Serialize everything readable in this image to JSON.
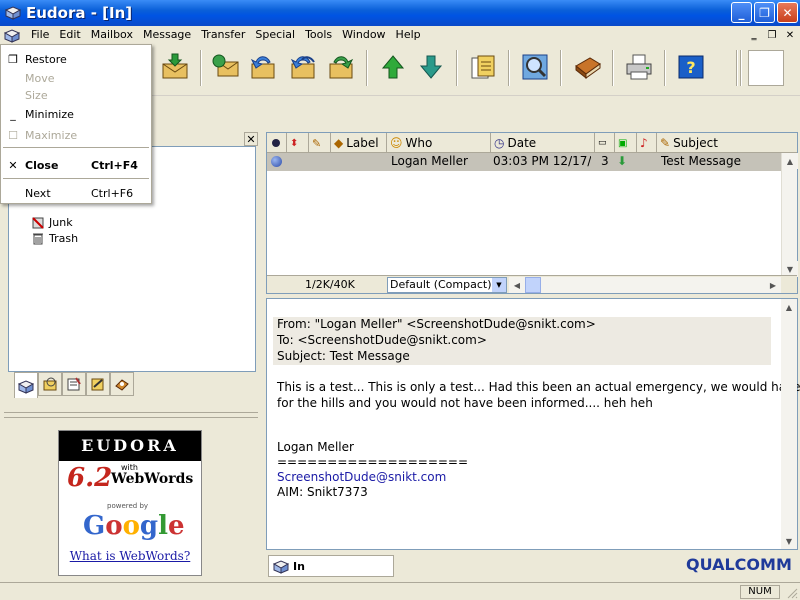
{
  "window": {
    "title": "Eudora - [In]"
  },
  "menubar": {
    "items": [
      "File",
      "Edit",
      "Mailbox",
      "Message",
      "Transfer",
      "Special",
      "Tools",
      "Window",
      "Help"
    ]
  },
  "system_menu": {
    "items": [
      {
        "label": "Restore",
        "shortcut": "",
        "enabled": true,
        "icon": "restore-icon"
      },
      {
        "label": "Move",
        "shortcut": "",
        "enabled": false,
        "icon": ""
      },
      {
        "label": "Size",
        "shortcut": "",
        "enabled": false,
        "icon": ""
      },
      {
        "label": "Minimize",
        "shortcut": "",
        "enabled": true,
        "icon": "minimize-icon"
      },
      {
        "label": "Maximize",
        "shortcut": "",
        "enabled": false,
        "icon": "maximize-icon"
      },
      {
        "label": "Close",
        "shortcut": "Ctrl+F4",
        "enabled": true,
        "icon": "close-icon"
      },
      {
        "label": "Next",
        "shortcut": "Ctrl+F6",
        "enabled": true,
        "icon": ""
      }
    ]
  },
  "toolbar": {
    "buttons": [
      "check-mail-icon",
      "new-message-icon",
      "reply-icon",
      "reply-all-icon",
      "forward-icon",
      "redirect-icon",
      "next-message-up-icon",
      "next-message-down-icon",
      "attach-file-icon",
      "find-icon",
      "address-book-icon",
      "print-icon",
      "help-icon"
    ]
  },
  "mailbox_tree": {
    "items": [
      {
        "label": "Junk",
        "icon": "junk-mailbox-icon"
      },
      {
        "label": "Trash",
        "icon": "trash-mailbox-icon"
      }
    ]
  },
  "message_list": {
    "columns": [
      "Label",
      "Who",
      "Date",
      "Subject"
    ],
    "messages": [
      {
        "status": "unread-dot",
        "who": "Logan Meller",
        "date": "03:03 PM 12/17/",
        "size": "3",
        "subject": "Test Message"
      }
    ],
    "size_info": "1/2K/40K",
    "view": "Default (Compact)"
  },
  "preview": {
    "from": "From: \"Logan Meller\" <ScreenshotDude@snikt.com>",
    "to": "To: <ScreenshotDude@snikt.com>",
    "subject": "Subject: Test Message",
    "body_line1": "This is a test... This is only a test... Had this been an actual emergency, we would have fled",
    "body_line2": "for the hills and you would not have been informed.... heh heh",
    "sig_name": "Logan Meller",
    "sig_rule": "===================",
    "sig_email": "ScreenshotDude@snikt.com",
    "sig_aim": "AIM: Snikt7373"
  },
  "ad": {
    "brand": "EUDORA",
    "version": "6.2",
    "with": "with",
    "product": "WebWords",
    "powered_by": "powered by",
    "google": "Google",
    "link": "What is WebWords?"
  },
  "mailbox_tab": {
    "label": "In"
  },
  "footer": {
    "logo": "QUALCOMM",
    "num_indicator": "NUM"
  },
  "colors": {
    "title_bar": "#0054e3",
    "selection": "#c5c2b8",
    "menu_highlight": "#316ac5"
  }
}
